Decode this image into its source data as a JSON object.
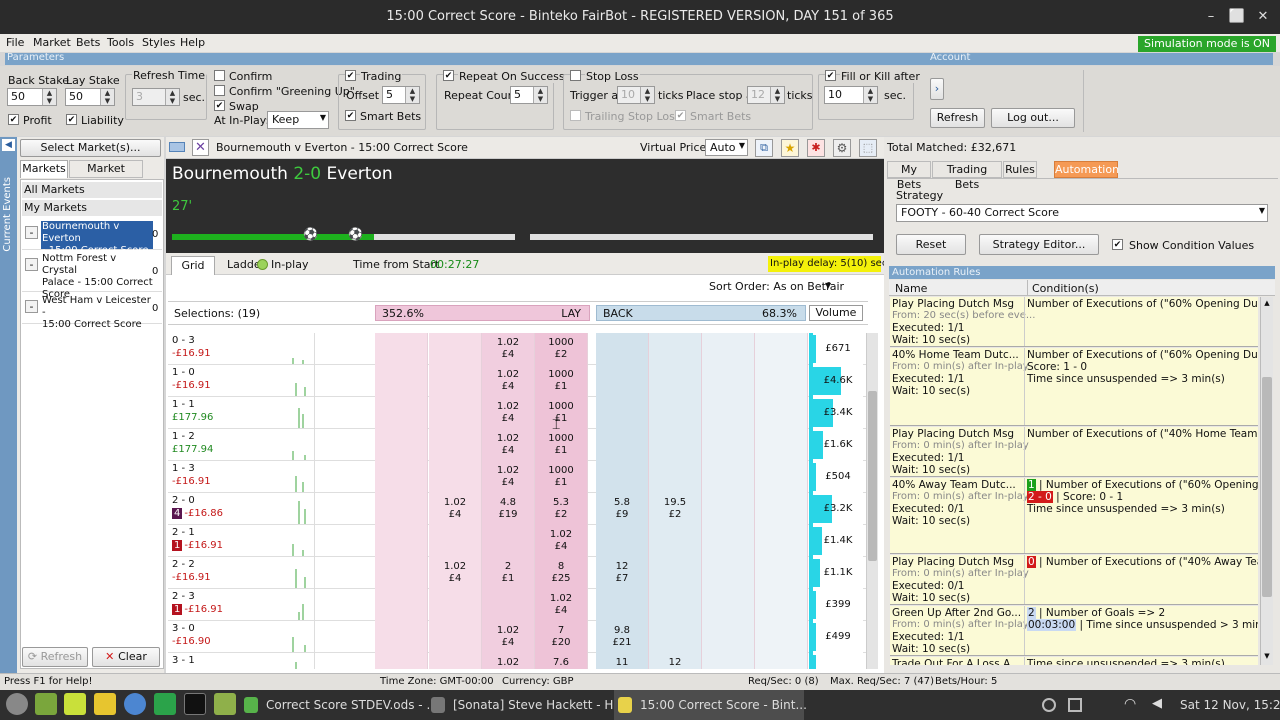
{
  "window": {
    "title": "15:00 Correct Score - Binteko FairBot - REGISTERED VERSION, DAY 151 of 365",
    "btn_min": "–",
    "btn_max": "⬜",
    "btn_close": "✕"
  },
  "menu": [
    "File",
    "Market",
    "Bets",
    "Tools",
    "Styles",
    "Help"
  ],
  "sim_badge": "Simulation mode is ON",
  "params_bar": {
    "left": "Parameters",
    "right": "Account"
  },
  "params": {
    "back_stake_label": "Back Stake",
    "back_stake": "50",
    "lay_stake_label": "Lay Stake",
    "lay_stake": "50",
    "profit": "Profit",
    "liability": "Liability",
    "refresh_time_label": "Refresh Time",
    "refresh_time": "3",
    "sec": "sec.",
    "confirm": "Confirm",
    "confirm_greening": "Confirm \"Greening Up\"",
    "swap": "Swap",
    "at_inplay_label": "At In-Play:",
    "at_inplay": "Keep",
    "trading": "Trading",
    "offset_label": "Offset",
    "offset": "5",
    "smart_bets": "Smart Bets",
    "repeat_on_success": "Repeat On Success",
    "repeat_count_label": "Repeat Count",
    "repeat_count": "5",
    "stop_loss": "Stop Loss",
    "trigger_at_label": "Trigger at",
    "trigger_at": "10",
    "ticks": "ticks",
    "place_stop_label": "Place stop at",
    "place_stop": "12",
    "trailing": "Trailing Stop Loss",
    "smart_bets2": "Smart Bets",
    "fill_or_kill": "Fill or Kill after",
    "fok_value": "10",
    "fok_sec": "sec.",
    "arrow_btn": "›",
    "refresh_btn": "Refresh",
    "logout_btn": "Log out..."
  },
  "left": {
    "vertical_tab": "Current Events",
    "select_markets": "Select Market(s)...",
    "tabs": [
      "Markets",
      "Market Search"
    ],
    "all_markets": "All Markets",
    "my_markets": "My Markets",
    "items": [
      {
        "toggle": "-",
        "line1": "Bournemouth v Everton",
        "line2": "- 15:00 Correct Score",
        "line3": "",
        "count": "0",
        "selected": true
      },
      {
        "toggle": "-",
        "line1": "Nottm Forest v Crystal",
        "line2": "Palace - 15:00 Correct",
        "line3": "Score",
        "count": "0",
        "selected": false
      },
      {
        "toggle": "-",
        "line1": "West Ham v Leicester -",
        "line2": "15:00 Correct Score",
        "line3": "",
        "count": "0",
        "selected": false
      }
    ],
    "refresh_btn": "Refresh",
    "clear_btn": "Clear"
  },
  "center": {
    "market_title": "Bournemouth v Everton - 15:00 Correct Score",
    "virtual_prices_label": "Virtual Prices",
    "virtual_prices": "Auto",
    "home": "Bournemouth",
    "score": "2-0",
    "away": "Everton",
    "minute": "27'",
    "progress_fraction": 0.59,
    "tabs": [
      "Grid",
      "Ladder",
      "In-play"
    ],
    "time_from_start_label": "Time from Start",
    "time_from_start": "00:27:27",
    "inplay_delay": "In-play delay: 5(10) sec.",
    "sort_order": "Sort Order: As on Betfair",
    "selections": "Selections: (19)",
    "lay_pct": "352.6%",
    "lay": "LAY",
    "back": "BACK",
    "back_pct": "68.3%",
    "volume": "Volume",
    "rows": [
      {
        "name": "0 - 3",
        "pl": "-£16.91",
        "neg": true,
        "badge": "",
        "c1": "",
        "c2": "",
        "c3": "1.02|£4",
        "c4": "1000|£2",
        "b1": "",
        "b2": "",
        "vol": "£671",
        "vw": 0.05
      },
      {
        "name": "1 - 0",
        "pl": "-£16.91",
        "neg": true,
        "badge": "",
        "c1": "",
        "c2": "",
        "c3": "1.02|£4",
        "c4": "1000|£1",
        "b1": "",
        "b2": "",
        "vol": "£4.6K",
        "vw": 0.55
      },
      {
        "name": "1 - 1",
        "pl": "£177.96",
        "neg": false,
        "badge": "",
        "c1": "",
        "c2": "",
        "c3": "1.02|£4",
        "c4": "1000|£1",
        "b1": "",
        "b2": "",
        "vol": "£3.4K",
        "vw": 0.4
      },
      {
        "name": "1 - 2",
        "pl": "£177.94",
        "neg": false,
        "badge": "",
        "c1": "",
        "c2": "",
        "c3": "1.02|£4",
        "c4": "1000|£1",
        "b1": "",
        "b2": "",
        "vol": "£1.6K",
        "vw": 0.2
      },
      {
        "name": "1 - 3",
        "pl": "-£16.91",
        "neg": true,
        "badge": "",
        "c1": "",
        "c2": "",
        "c3": "1.02|£4",
        "c4": "1000|£1",
        "b1": "",
        "b2": "",
        "vol": "£504",
        "vw": 0.05
      },
      {
        "name": "2 - 0",
        "pl": "-£16.86",
        "neg": true,
        "badge": "4",
        "c1": "",
        "c2": "1.02|£4",
        "c3": "4.8|£19",
        "c4": "5.3|£2",
        "b1": "5.8|£9",
        "b2": "19.5|£2",
        "vol": "£3.2K",
        "vw": 0.38
      },
      {
        "name": "2 - 1",
        "pl": "-£16.91",
        "neg": true,
        "badge": "1",
        "c1": "",
        "c2": "",
        "c3": "",
        "c4": "1.02|£4",
        "b1": "",
        "b2": "",
        "vol": "£1.4K",
        "vw": 0.18
      },
      {
        "name": "2 - 2",
        "pl": "-£16.91",
        "neg": true,
        "badge": "",
        "c1": "",
        "c2": "1.02|£4",
        "c3": "2|£1",
        "c4": "8|£25",
        "b1": "12|£7",
        "b2": "",
        "vol": "£1.1K",
        "vw": 0.14
      },
      {
        "name": "2 - 3",
        "pl": "-£16.91",
        "neg": true,
        "badge": "1",
        "c1": "",
        "c2": "",
        "c3": "",
        "c4": "1.02|£4",
        "b1": "",
        "b2": "",
        "vol": "£399",
        "vw": 0.05
      },
      {
        "name": "3 - 0",
        "pl": "-£16.90",
        "neg": true,
        "badge": "",
        "c1": "",
        "c2": "",
        "c3": "1.02|£4",
        "c4": "7|£20",
        "b1": "9.8|£21",
        "b2": "",
        "vol": "£499",
        "vw": 0.05
      },
      {
        "name": "3 - 1",
        "pl": "",
        "neg": true,
        "badge": "",
        "c1": "",
        "c2": "",
        "c3": "1.02",
        "c4": "7.6",
        "b1": "11",
        "b2": "12",
        "vol": "",
        "vw": 0.05
      }
    ]
  },
  "right": {
    "total_matched": "Total Matched: £32,671",
    "tabs": [
      "My Bets",
      "Trading Bets",
      "Rules",
      "Automation"
    ],
    "strategy_label": "Strategy",
    "strategy": "FOOTY - 60-40 Correct Score",
    "reset": "Reset",
    "editor": "Strategy Editor...",
    "show_values": "Show Condition Values",
    "rules_header": "Automation Rules",
    "col_name": "Name",
    "col_cond": "Condition(s)",
    "rules": [
      {
        "name": "Play Placing Dutch Msg",
        "from": "From: 20 sec(s) before eve...",
        "exec": "Executed: 1/1",
        "wait": "Wait: 10 sec(s)",
        "cond": [
          "Number of Executions of (\"60% Opening Dutch o..."
        ],
        "tag": [],
        "h": 50
      },
      {
        "name": "40% Home Team Dutc...",
        "from": "From: 0 min(s) after In-play",
        "exec": "Executed: 1/1",
        "wait": "Wait: 10 sec(s)",
        "cond": [
          "Number of Executions of (\"60% Opening Dutch o...",
          "Score: 1 - 0",
          "Time since unsuspended => 3 min(s)"
        ],
        "tag": [],
        "h": 78
      },
      {
        "name": "Play Placing Dutch Msg",
        "from": "From: 0 min(s) after In-play",
        "exec": "Executed: 1/1",
        "wait": "Wait: 10 sec(s)",
        "cond": [
          "Number of Executions of (\"40% Home Team Dutc..."
        ],
        "tag": [],
        "h": 50
      },
      {
        "name": "40% Away Team Dutc...",
        "from": "From: 0 min(s) after In-play",
        "exec": "Executed: 0/1",
        "wait": "Wait: 10 sec(s)",
        "cond": [
          "| Number of Executions of (\"60% Opening Dutc...",
          "| Score: 0 - 1",
          "Time since unsuspended => 3 min(s)"
        ],
        "tag": [
          "1",
          "2 - 0",
          ""
        ],
        "h": 76
      },
      {
        "name": "Play Placing Dutch Msg",
        "from": "From: 0 min(s) after In-play",
        "exec": "Executed: 0/1",
        "wait": "Wait: 10 sec(s)",
        "cond": [
          "| Number of Executions of (\"40% Away Team ..."
        ],
        "tag": [
          "0"
        ],
        "h": 50
      },
      {
        "name": "Green Up After 2nd Go...",
        "from": "From: 0 min(s) after In-play",
        "exec": "Executed: 1/1",
        "wait": "Wait: 10 sec(s)",
        "cond": [
          "| Number of Goals => 2",
          "| Time since unsuspended > 3 min(s)"
        ],
        "tag": [
          "2",
          "00:03:00"
        ],
        "h": 50
      },
      {
        "name": "Trade Out For A Loss A...",
        "from": "",
        "exec": "",
        "wait": "",
        "cond": [
          "Time since unsuspended => 3 min(s)"
        ],
        "tag": [],
        "h": 14
      }
    ]
  },
  "status": {
    "help": "Press F1 for Help!",
    "tz": "Time Zone: GMT-00:00",
    "cur": "Currency: GBP",
    "req": "Req/Sec: 0 (8)",
    "maxreq": "Max. Req/Sec: 7 (47)",
    "bets": "Bets/Hour: 5"
  },
  "taskbar": {
    "w1": "Correct Score STDEV.ods - ...",
    "w2": "[Sonata] Steve Hackett - H...",
    "w3": "15:00 Correct Score - Bint...",
    "clock": "Sat 12 Nov, 15:28"
  }
}
